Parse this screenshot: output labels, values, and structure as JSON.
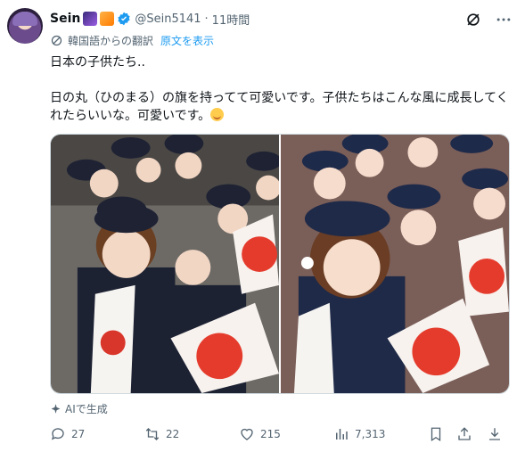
{
  "post": {
    "display_name": "Sein",
    "handle": "@Sein5141",
    "separator": "·",
    "time": "11時間",
    "translation_note": "韓国語からの翻訳",
    "show_original": "原文を表示",
    "text_line1": "日本の子供たち..",
    "text_line2": "日の丸（ひのまる）の旗を持ってて可愛いです。子供たちはこんな風に成長してくれたらいいな。可愛いです。",
    "ai_label": "AIで生成"
  },
  "actions": {
    "replies": "27",
    "reposts": "22",
    "likes": "215",
    "views": "7,313"
  },
  "colors": {
    "accent": "#1d9bf0",
    "muted": "#536471"
  },
  "icons": [
    "grok-icon",
    "more-icon",
    "translate-icon",
    "sparkle-icon",
    "reply-icon",
    "repost-icon",
    "like-icon",
    "views-icon",
    "bookmark-icon",
    "share-icon"
  ]
}
